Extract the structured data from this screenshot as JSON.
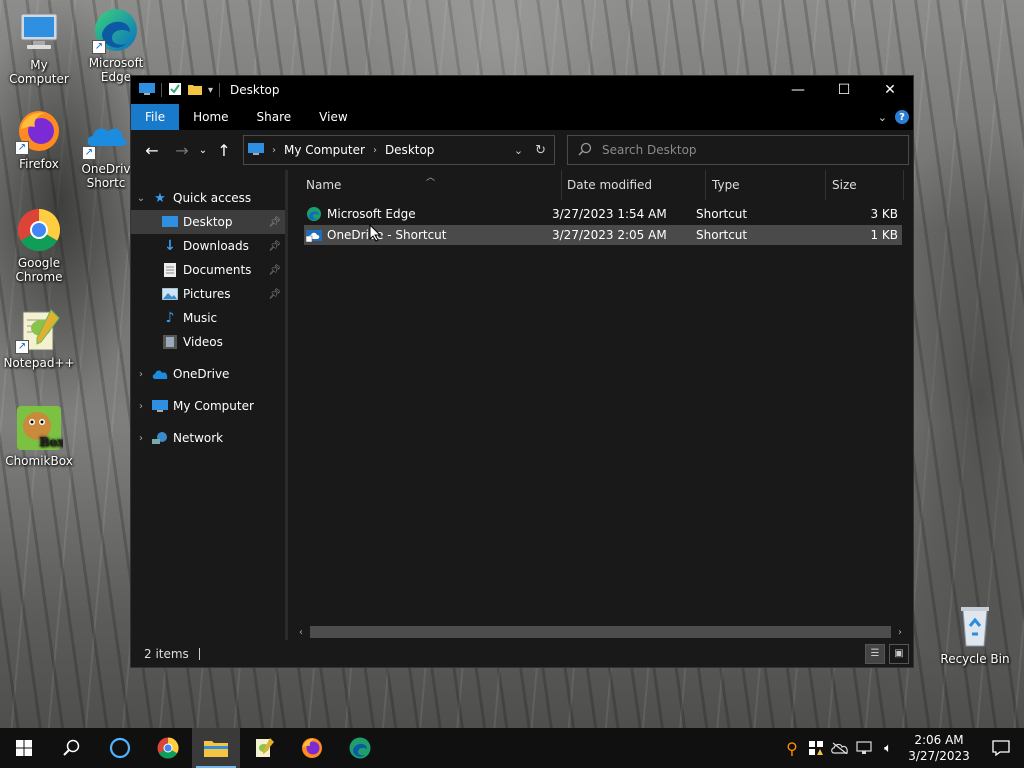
{
  "desktop_icons": [
    {
      "label": "My Computer"
    },
    {
      "label": "Microsoft Edge"
    },
    {
      "label": "Firefox"
    },
    {
      "label": "OneDrive - Shortcut",
      "visible_label": "OneDriv Shortc"
    },
    {
      "label": "Google Chrome"
    },
    {
      "label": "Notepad++"
    },
    {
      "label": "ChomikBox"
    },
    {
      "label": "Recycle Bin"
    }
  ],
  "window": {
    "title": "Desktop",
    "controls": {
      "minimize": "—",
      "maximize": "☐",
      "close": "✕"
    },
    "ribbon_tabs": [
      "File",
      "Home",
      "Share",
      "View"
    ],
    "help_label": "?"
  },
  "navigation": {
    "breadcrumb": [
      "My Computer",
      "Desktop"
    ],
    "search_placeholder": "Search Desktop"
  },
  "nav_pane": {
    "quick_access": "Quick access",
    "quick_items": [
      {
        "label": "Desktop",
        "pinned": true,
        "selected": true
      },
      {
        "label": "Downloads",
        "pinned": true
      },
      {
        "label": "Documents",
        "pinned": true
      },
      {
        "label": "Pictures",
        "pinned": true
      },
      {
        "label": "Music"
      },
      {
        "label": "Videos"
      }
    ],
    "roots": [
      "OneDrive",
      "My Computer",
      "Network"
    ]
  },
  "file_list": {
    "columns": [
      "Name",
      "Date modified",
      "Type",
      "Size"
    ],
    "rows": [
      {
        "name": "Microsoft Edge",
        "date": "3/27/2023 1:54 AM",
        "type": "Shortcut",
        "size": "3 KB",
        "selected": false
      },
      {
        "name": "OneDrive - Shortcut",
        "date": "3/27/2023 2:05 AM",
        "type": "Shortcut",
        "size": "1 KB",
        "selected": true
      }
    ]
  },
  "status": {
    "item_count": "2 items"
  },
  "taskbar": {
    "time": "2:06 AM",
    "date": "3/27/2023",
    "pinned": [
      "start-icon",
      "search-icon",
      "cortana-icon",
      "chrome-icon",
      "file-explorer-icon",
      "notepadpp-icon",
      "firefox-icon",
      "edge-icon"
    ]
  },
  "colors": {
    "accent": "#1979ca",
    "window_bg": "#191919",
    "selection": "#4a4a4a"
  }
}
